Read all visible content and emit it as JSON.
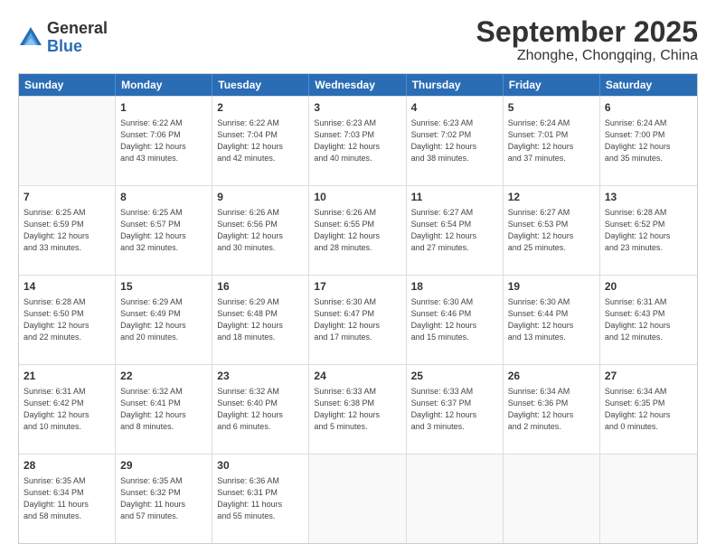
{
  "logo": {
    "general": "General",
    "blue": "Blue"
  },
  "title": "September 2025",
  "location": "Zhonghe, Chongqing, China",
  "days_header": [
    "Sunday",
    "Monday",
    "Tuesday",
    "Wednesday",
    "Thursday",
    "Friday",
    "Saturday"
  ],
  "weeks": [
    [
      {
        "day": "",
        "lines": []
      },
      {
        "day": "1",
        "lines": [
          "Sunrise: 6:22 AM",
          "Sunset: 7:06 PM",
          "Daylight: 12 hours",
          "and 43 minutes."
        ]
      },
      {
        "day": "2",
        "lines": [
          "Sunrise: 6:22 AM",
          "Sunset: 7:04 PM",
          "Daylight: 12 hours",
          "and 42 minutes."
        ]
      },
      {
        "day": "3",
        "lines": [
          "Sunrise: 6:23 AM",
          "Sunset: 7:03 PM",
          "Daylight: 12 hours",
          "and 40 minutes."
        ]
      },
      {
        "day": "4",
        "lines": [
          "Sunrise: 6:23 AM",
          "Sunset: 7:02 PM",
          "Daylight: 12 hours",
          "and 38 minutes."
        ]
      },
      {
        "day": "5",
        "lines": [
          "Sunrise: 6:24 AM",
          "Sunset: 7:01 PM",
          "Daylight: 12 hours",
          "and 37 minutes."
        ]
      },
      {
        "day": "6",
        "lines": [
          "Sunrise: 6:24 AM",
          "Sunset: 7:00 PM",
          "Daylight: 12 hours",
          "and 35 minutes."
        ]
      }
    ],
    [
      {
        "day": "7",
        "lines": [
          "Sunrise: 6:25 AM",
          "Sunset: 6:59 PM",
          "Daylight: 12 hours",
          "and 33 minutes."
        ]
      },
      {
        "day": "8",
        "lines": [
          "Sunrise: 6:25 AM",
          "Sunset: 6:57 PM",
          "Daylight: 12 hours",
          "and 32 minutes."
        ]
      },
      {
        "day": "9",
        "lines": [
          "Sunrise: 6:26 AM",
          "Sunset: 6:56 PM",
          "Daylight: 12 hours",
          "and 30 minutes."
        ]
      },
      {
        "day": "10",
        "lines": [
          "Sunrise: 6:26 AM",
          "Sunset: 6:55 PM",
          "Daylight: 12 hours",
          "and 28 minutes."
        ]
      },
      {
        "day": "11",
        "lines": [
          "Sunrise: 6:27 AM",
          "Sunset: 6:54 PM",
          "Daylight: 12 hours",
          "and 27 minutes."
        ]
      },
      {
        "day": "12",
        "lines": [
          "Sunrise: 6:27 AM",
          "Sunset: 6:53 PM",
          "Daylight: 12 hours",
          "and 25 minutes."
        ]
      },
      {
        "day": "13",
        "lines": [
          "Sunrise: 6:28 AM",
          "Sunset: 6:52 PM",
          "Daylight: 12 hours",
          "and 23 minutes."
        ]
      }
    ],
    [
      {
        "day": "14",
        "lines": [
          "Sunrise: 6:28 AM",
          "Sunset: 6:50 PM",
          "Daylight: 12 hours",
          "and 22 minutes."
        ]
      },
      {
        "day": "15",
        "lines": [
          "Sunrise: 6:29 AM",
          "Sunset: 6:49 PM",
          "Daylight: 12 hours",
          "and 20 minutes."
        ]
      },
      {
        "day": "16",
        "lines": [
          "Sunrise: 6:29 AM",
          "Sunset: 6:48 PM",
          "Daylight: 12 hours",
          "and 18 minutes."
        ]
      },
      {
        "day": "17",
        "lines": [
          "Sunrise: 6:30 AM",
          "Sunset: 6:47 PM",
          "Daylight: 12 hours",
          "and 17 minutes."
        ]
      },
      {
        "day": "18",
        "lines": [
          "Sunrise: 6:30 AM",
          "Sunset: 6:46 PM",
          "Daylight: 12 hours",
          "and 15 minutes."
        ]
      },
      {
        "day": "19",
        "lines": [
          "Sunrise: 6:30 AM",
          "Sunset: 6:44 PM",
          "Daylight: 12 hours",
          "and 13 minutes."
        ]
      },
      {
        "day": "20",
        "lines": [
          "Sunrise: 6:31 AM",
          "Sunset: 6:43 PM",
          "Daylight: 12 hours",
          "and 12 minutes."
        ]
      }
    ],
    [
      {
        "day": "21",
        "lines": [
          "Sunrise: 6:31 AM",
          "Sunset: 6:42 PM",
          "Daylight: 12 hours",
          "and 10 minutes."
        ]
      },
      {
        "day": "22",
        "lines": [
          "Sunrise: 6:32 AM",
          "Sunset: 6:41 PM",
          "Daylight: 12 hours",
          "and 8 minutes."
        ]
      },
      {
        "day": "23",
        "lines": [
          "Sunrise: 6:32 AM",
          "Sunset: 6:40 PM",
          "Daylight: 12 hours",
          "and 6 minutes."
        ]
      },
      {
        "day": "24",
        "lines": [
          "Sunrise: 6:33 AM",
          "Sunset: 6:38 PM",
          "Daylight: 12 hours",
          "and 5 minutes."
        ]
      },
      {
        "day": "25",
        "lines": [
          "Sunrise: 6:33 AM",
          "Sunset: 6:37 PM",
          "Daylight: 12 hours",
          "and 3 minutes."
        ]
      },
      {
        "day": "26",
        "lines": [
          "Sunrise: 6:34 AM",
          "Sunset: 6:36 PM",
          "Daylight: 12 hours",
          "and 2 minutes."
        ]
      },
      {
        "day": "27",
        "lines": [
          "Sunrise: 6:34 AM",
          "Sunset: 6:35 PM",
          "Daylight: 12 hours",
          "and 0 minutes."
        ]
      }
    ],
    [
      {
        "day": "28",
        "lines": [
          "Sunrise: 6:35 AM",
          "Sunset: 6:34 PM",
          "Daylight: 11 hours",
          "and 58 minutes."
        ]
      },
      {
        "day": "29",
        "lines": [
          "Sunrise: 6:35 AM",
          "Sunset: 6:32 PM",
          "Daylight: 11 hours",
          "and 57 minutes."
        ]
      },
      {
        "day": "30",
        "lines": [
          "Sunrise: 6:36 AM",
          "Sunset: 6:31 PM",
          "Daylight: 11 hours",
          "and 55 minutes."
        ]
      },
      {
        "day": "",
        "lines": []
      },
      {
        "day": "",
        "lines": []
      },
      {
        "day": "",
        "lines": []
      },
      {
        "day": "",
        "lines": []
      }
    ]
  ]
}
